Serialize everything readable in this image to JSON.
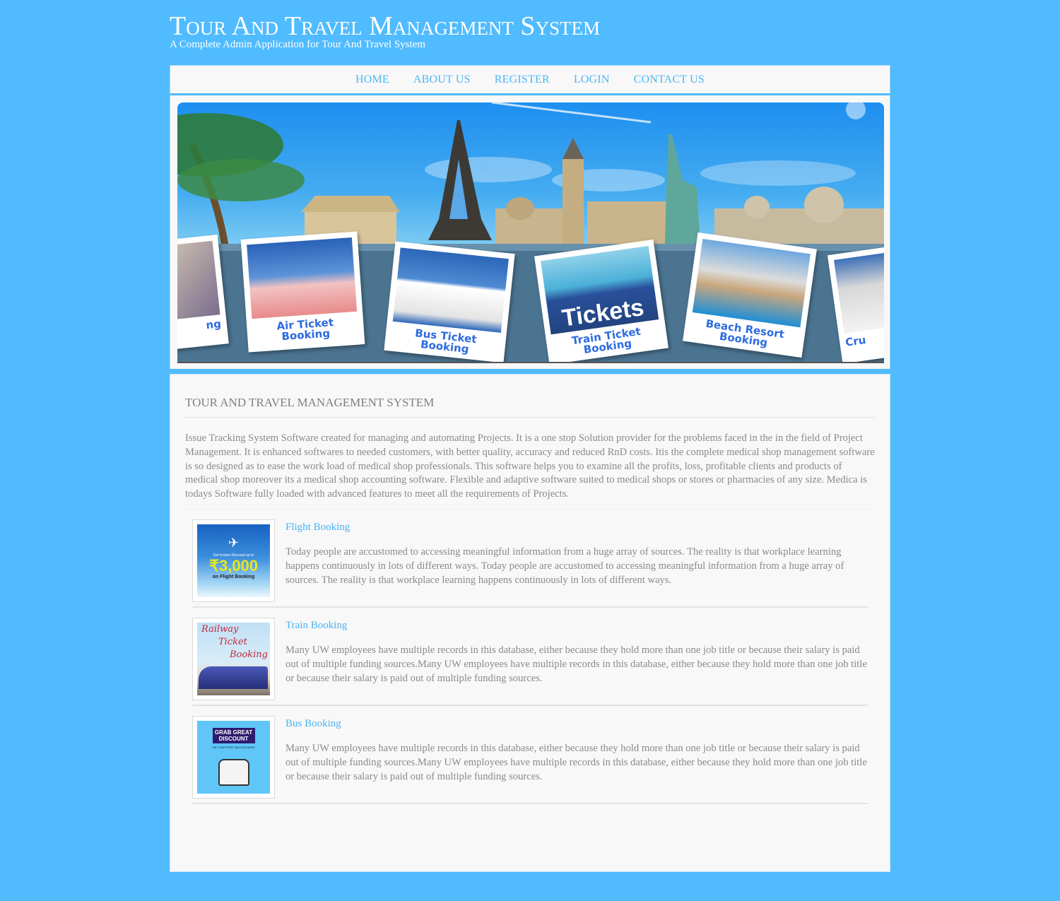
{
  "header": {
    "title": "Tour And Travel Management System",
    "subtitle": "A Complete Admin Application for Tour And Travel System"
  },
  "nav": {
    "items": [
      {
        "label": "HOME"
      },
      {
        "label": "ABOUT US"
      },
      {
        "label": "REGISTER"
      },
      {
        "label": "LOGIN"
      },
      {
        "label": "CONTACT US"
      }
    ]
  },
  "banner": {
    "cards": [
      {
        "caption": "ng"
      },
      {
        "caption": "Air Ticket Booking"
      },
      {
        "caption": "Bus Ticket Booking"
      },
      {
        "caption": "Train Ticket Booking",
        "photo_text": "Tickets"
      },
      {
        "caption": "Beach Resort Booking"
      },
      {
        "caption": "Cru"
      }
    ]
  },
  "main": {
    "heading": "TOUR AND TRAVEL MANAGEMENT SYSTEM",
    "intro": "Issue Tracking System Software created for managing and automating Projects. It is a one stop Solution provider for the problems faced in the in the field of Project Management. It is enhanced softwares to needed customers, with better quality, accuracy and reduced RnD costs. Itis the complete medical shop management software is so designed as to ease the work load of medical shop professionals. This software helps you to examine all the profits, loss, profitable clients and products of medical shop moreover its a medical shop accounting software. Flexible and adaptive software suited to medical shops or stores or pharmacies of any size. Medica is todays Software fully loaded with advanced features to meet all the requirements of Projects.",
    "services": [
      {
        "title": "Flight Booking",
        "description": "Today people are accustomed to accessing meaningful information from a huge array of sources. The reality is that workplace learning happens continuously in lots of different ways. Today people are accustomed to accessing meaningful information from a huge array of sources. The reality is that workplace learning happens continuously in lots of different ways.",
        "thumb": {
          "line1": "Get Instant Discount up to",
          "amount": "₹3,000",
          "line2": "on Flight Booking"
        }
      },
      {
        "title": "Train Booking",
        "description": "Many UW employees have multiple records in this database, either because they hold more than one job title or because their salary is paid out of multiple funding sources.Many UW employees have multiple records in this database, either because they hold more than one job title or because their salary is paid out of multiple funding sources.",
        "thumb": {
          "line1": "Railway",
          "line2": "Ticket",
          "line3": "Booking"
        }
      },
      {
        "title": "Bus Booking",
        "description": "Many UW employees have multiple records in this database, either because they hold more than one job title or because their salary is paid out of multiple funding sources.Many UW employees have multiple records in this database, either because they hold more than one job title or because their salary is paid out of multiple funding sources.",
        "thumb": {
          "line1": "GRAB GREAT",
          "line2": "DISCOUNT",
          "line3": "ON YOUR FIRST BUS BOOKING"
        }
      }
    ]
  },
  "colors": {
    "background": "#50bbfe",
    "accent": "#49b3f4",
    "text": "#8a8a8a",
    "panel": "#f8f8f8"
  }
}
